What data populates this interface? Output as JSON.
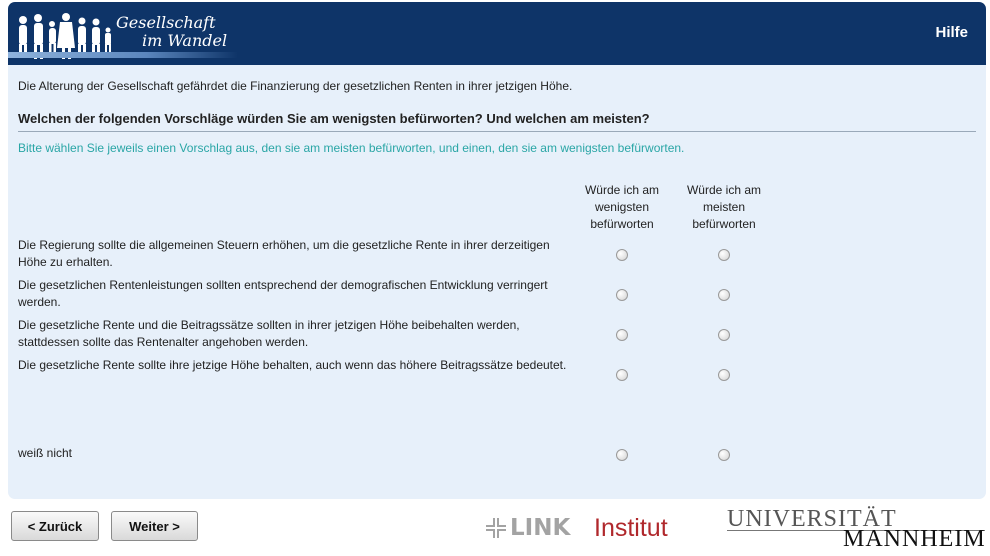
{
  "header": {
    "logo_line1": "Gesellschaft",
    "logo_line2": "im Wandel",
    "help_label": "Hilfe",
    "colors": {
      "header_bg": "#0e3468",
      "panel_bg": "#e7f0fa",
      "hint": "#2aa6a6"
    }
  },
  "survey": {
    "intro": "Die Alterung der Gesellschaft gefährdet die Finanzierung der gesetzlichen Renten in ihrer jetzigen Höhe.",
    "question": "Welchen der folgenden Vorschläge würden Sie am wenigsten befürworten? Und welchen am meisten?",
    "hint": "Bitte wählen Sie jeweils einen Vorschlag aus, den sie am meisten befürworten, und einen, den sie am wenigsten befürworten.",
    "col_least": "Würde ich am wenigsten befürworten",
    "col_most": "Würde ich am meisten befürworten",
    "options": [
      "Die Regierung sollte die allgemeinen Steuern erhöhen, um die gesetzliche Rente in ihrer derzeitigen Höhe zu erhalten.",
      "Die gesetzlichen Rentenleistungen sollten entsprechend der demografischen Entwicklung verringert werden.",
      "Die gesetzliche Rente und die Beitragssätze sollten in ihrer jetzigen Höhe beibehalten werden, stattdessen sollte das Rentenalter angehoben werden.",
      "Die gesetzliche Rente sollte ihre jetzige Höhe behalten, auch wenn das höhere Beitragssätze bedeutet."
    ],
    "dont_know": "weiß nicht"
  },
  "nav": {
    "back_label": "< Zurück",
    "next_label": "Weiter >"
  },
  "footer": {
    "link_bold": "LINK",
    "link_institut": "Institut",
    "uni_line1": "UNIVERSITÄT",
    "uni_line2": "MANNHEIM"
  }
}
